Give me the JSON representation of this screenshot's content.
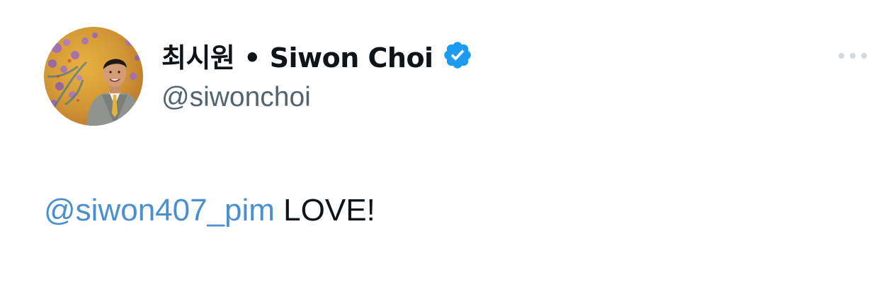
{
  "author": {
    "display_name": "최시원 • Siwon Choi",
    "handle": "@siwonchoi",
    "verified": true,
    "avatar_icon": "profile-photo"
  },
  "menu": {
    "icon": "more-horizontal-icon"
  },
  "tweet": {
    "mention": "@siwon407_pim",
    "text": " LOVE!"
  },
  "colors": {
    "verified_badge": "#1d9bf0",
    "mention": "#4a90d0",
    "handle": "#536471",
    "text": "#0f1419"
  }
}
